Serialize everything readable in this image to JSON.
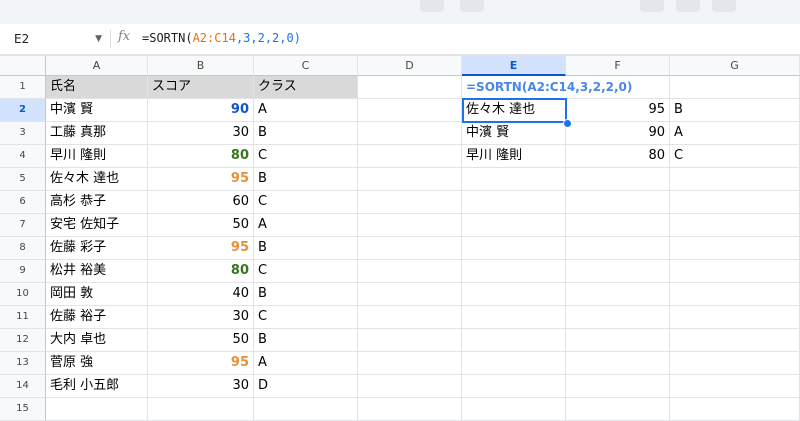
{
  "formula_bar": {
    "name_box": "E2",
    "fx_label": "fx",
    "formula_prefix": "=SORTN(",
    "formula_range": "A2:C14",
    "formula_args": ",3,2,2,0)"
  },
  "columns": [
    "A",
    "B",
    "C",
    "D",
    "E",
    "F",
    "G"
  ],
  "selected_column": "E",
  "rows": [
    "1",
    "2",
    "3",
    "4",
    "5",
    "6",
    "7",
    "8",
    "9",
    "10",
    "11",
    "12",
    "13",
    "14",
    "15"
  ],
  "selected_row": "2",
  "table": {
    "header": {
      "name": "氏名",
      "score": "スコア",
      "class": "クラス"
    },
    "records": [
      {
        "name": "中濱 賢",
        "score": "90",
        "class": "A",
        "score_style": "blue"
      },
      {
        "name": "工藤 真那",
        "score": "30",
        "class": "B",
        "score_style": "plain"
      },
      {
        "name": "早川 隆則",
        "score": "80",
        "class": "C",
        "score_style": "green"
      },
      {
        "name": "佐々木 達也",
        "score": "95",
        "class": "B",
        "score_style": "orange"
      },
      {
        "name": "高杉 恭子",
        "score": "60",
        "class": "C",
        "score_style": "plain"
      },
      {
        "name": "安宅 佐知子",
        "score": "50",
        "class": "A",
        "score_style": "plain"
      },
      {
        "name": "佐藤 彩子",
        "score": "95",
        "class": "B",
        "score_style": "orange"
      },
      {
        "name": "松井 裕美",
        "score": "80",
        "class": "C",
        "score_style": "green"
      },
      {
        "name": "岡田 敦",
        "score": "40",
        "class": "B",
        "score_style": "plain"
      },
      {
        "name": "佐藤 裕子",
        "score": "30",
        "class": "C",
        "score_style": "plain"
      },
      {
        "name": "大内 卓也",
        "score": "50",
        "class": "B",
        "score_style": "plain"
      },
      {
        "name": "菅原 強",
        "score": "95",
        "class": "A",
        "score_style": "orange"
      },
      {
        "name": "毛利 小五郎",
        "score": "30",
        "class": "D",
        "score_style": "plain"
      }
    ]
  },
  "result": {
    "formula_text": "=SORTN(A2:C14,3,2,2,0)",
    "records": [
      {
        "name": "佐々木 達也",
        "score": "95",
        "class": "B"
      },
      {
        "name": "中濱 賢",
        "score": "90",
        "class": "A"
      },
      {
        "name": "早川 隆則",
        "score": "80",
        "class": "C"
      }
    ]
  },
  "colors": {
    "header_fill": "#d9d9d9",
    "score_blue": "#1155cc",
    "score_green": "#38761d",
    "score_orange": "#e69138",
    "selection": "#1a73e8",
    "selected_header": "#d3e3fd"
  }
}
